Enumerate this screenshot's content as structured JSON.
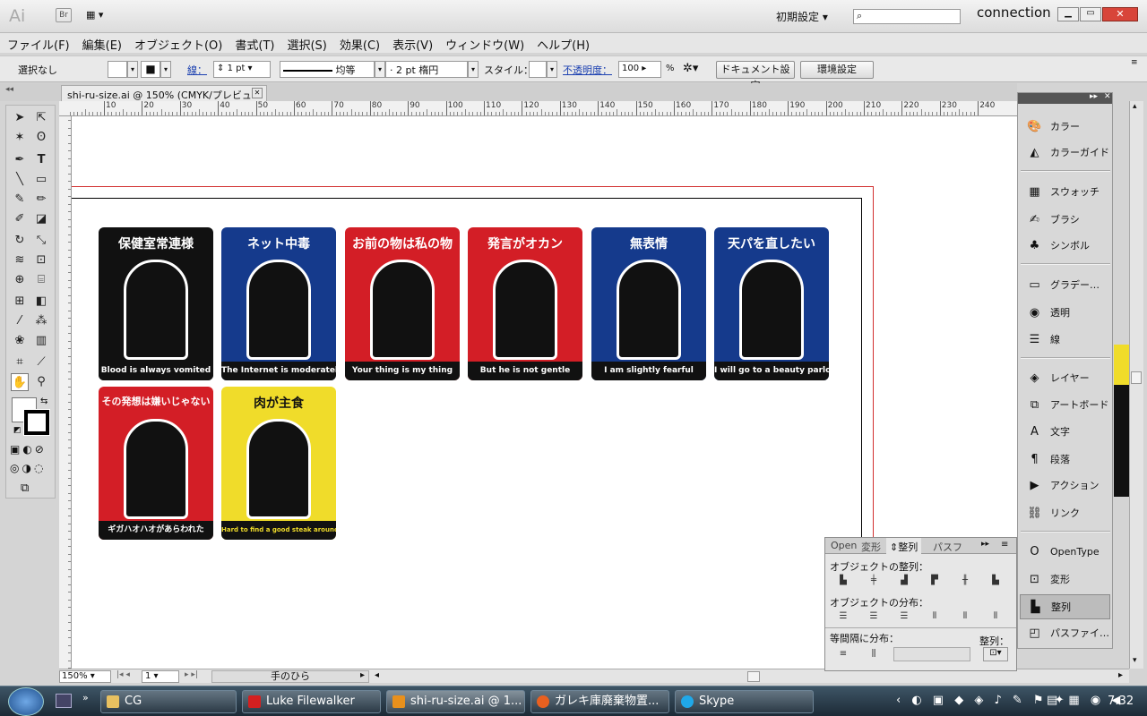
{
  "app": {
    "logo": "Ai",
    "bridge": "Br",
    "workspace": "初期設定",
    "search_placeholder": "",
    "connection": "connection"
  },
  "menu": [
    "ファイル(F)",
    "編集(E)",
    "オブジェクト(O)",
    "書式(T)",
    "選択(S)",
    "効果(C)",
    "表示(V)",
    "ウィンドウ(W)",
    "ヘルプ(H)"
  ],
  "control": {
    "selection": "選択なし",
    "stroke_label": "線：",
    "stroke_weight": "1 pt",
    "stroke_style": "均等",
    "brush": "2 pt 楕円",
    "style_label": "スタイル：",
    "opacity_label": "不透明度：",
    "opacity_value": "100",
    "opacity_unit": "%",
    "doc_settings": "ドキュメント設定",
    "prefs": "環境設定"
  },
  "document": {
    "tab": "shi-ru-size.ai @ 150% (CMYK/プレビュー)",
    "zoom": "150%",
    "page": "1",
    "tool_status": "手のひら"
  },
  "ruler": {
    "top": [
      "10",
      "20",
      "30",
      "40",
      "50",
      "60",
      "70",
      "80",
      "90",
      "100",
      "110",
      "120",
      "130",
      "140",
      "150",
      "160",
      "170",
      "180",
      "190",
      "200",
      "210",
      "220",
      "230",
      "240"
    ]
  },
  "cards": [
    {
      "title": "保健室常連様",
      "caption": "Blood is always vomited",
      "bg": "#111111"
    },
    {
      "title": "ネット中毒",
      "caption": "The Internet is moderately",
      "bg": "#153a8c"
    },
    {
      "title": "お前の物は私の物",
      "caption": "Your thing is my thing",
      "bg": "#d31e26"
    },
    {
      "title": "発言がオカン",
      "caption": "But he is not gentle",
      "bg": "#d31e26"
    },
    {
      "title": "無表情",
      "caption": "I am slightly fearful",
      "bg": "#153a8c"
    },
    {
      "title": "天パを直したい",
      "caption": "I will go to a beauty parlor",
      "bg": "#153a8c"
    },
    {
      "title": "その発想は嫌いじゃない",
      "caption": "ギガハオハオがあらわれた",
      "bg": "#d31e26"
    },
    {
      "title": "肉が主食",
      "caption": "Hard to find a good steak around here",
      "bg": "#f0dc2a"
    }
  ],
  "right_panel": {
    "groups": [
      [
        "カラー",
        "カラーガイド"
      ],
      [
        "スウォッチ",
        "ブラシ",
        "シンボル"
      ],
      [
        "グラデー…",
        "透明",
        "線"
      ],
      [
        "レイヤー",
        "アートボード",
        "文字",
        "段落",
        "アクション",
        "リンク"
      ],
      [
        "OpenType",
        "変形",
        "整列",
        "パスファイ…"
      ]
    ]
  },
  "align_panel": {
    "tabs": [
      "Open",
      "変形",
      "整列",
      "パスフ"
    ],
    "align_objects": "オブジェクトの整列：",
    "distribute_objects": "オブジェクトの分布：",
    "distribute_spacing": "等間隔に分布：",
    "align_to": "整列："
  },
  "taskbar": {
    "items": [
      {
        "label": "CG",
        "color": "#e8c060"
      },
      {
        "label": "Luke Filewalker",
        "color": "#d42020"
      },
      {
        "label": "shi-ru-size.ai @ 1...",
        "color": "#e8901c"
      },
      {
        "label": "ガレキ庫廃棄物置...",
        "color": "#e86020"
      },
      {
        "label": "Skype",
        "color": "#20a8e8"
      }
    ],
    "clock": "7:32"
  }
}
